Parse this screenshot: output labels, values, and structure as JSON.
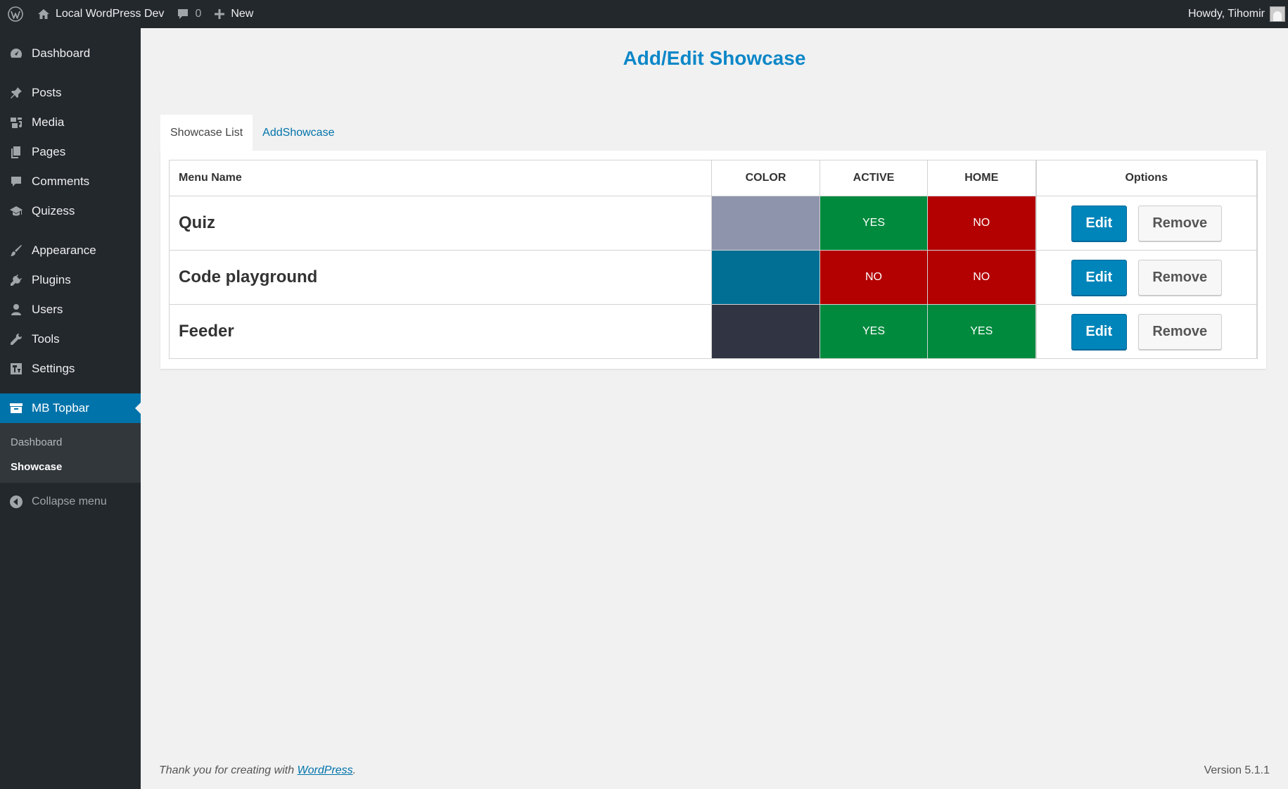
{
  "adminbar": {
    "site_name": "Local WordPress Dev",
    "comments_count": "0",
    "new_label": "New",
    "greeting": "Howdy, Tihomir"
  },
  "sidebar": {
    "items": [
      {
        "label": "Dashboard",
        "icon": "dashboard-icon"
      },
      {
        "label": "Posts",
        "icon": "pin-icon"
      },
      {
        "label": "Media",
        "icon": "media-icon"
      },
      {
        "label": "Pages",
        "icon": "pages-icon"
      },
      {
        "label": "Comments",
        "icon": "comment-icon"
      },
      {
        "label": "Quizess",
        "icon": "graduation-cap-icon"
      },
      {
        "label": "Appearance",
        "icon": "paintbrush-icon"
      },
      {
        "label": "Plugins",
        "icon": "plugin-icon"
      },
      {
        "label": "Users",
        "icon": "user-icon"
      },
      {
        "label": "Tools",
        "icon": "wrench-icon"
      },
      {
        "label": "Settings",
        "icon": "settings-icon"
      },
      {
        "label": "MB Topbar",
        "icon": "archive-icon"
      }
    ],
    "submenu": [
      "Dashboard",
      "Showcase"
    ],
    "collapse_label": "Collapse menu"
  },
  "main": {
    "title": "Add/Edit Showcase",
    "tabs": [
      "Showcase List",
      "AddShowcase"
    ],
    "table": {
      "headers": [
        "Menu Name",
        "COLOR",
        "ACTIVE",
        "HOME",
        "Options"
      ],
      "rows": [
        {
          "name": "Quiz",
          "color": "#8f94ad",
          "active": "YES",
          "home": "NO"
        },
        {
          "name": "Code playground",
          "color": "#006f93",
          "active": "NO",
          "home": "NO"
        },
        {
          "name": "Feeder",
          "color": "#313442",
          "active": "YES",
          "home": "YES"
        }
      ],
      "edit_label": "Edit",
      "remove_label": "Remove"
    }
  },
  "footer": {
    "thanks_prefix": "Thank you for creating with ",
    "wordpress_link": "WordPress",
    "thanks_suffix": ".",
    "version": "Version 5.1.1"
  },
  "colors": {
    "yes": "#008a3e",
    "no": "#b30000",
    "accent": "#0073aa"
  }
}
